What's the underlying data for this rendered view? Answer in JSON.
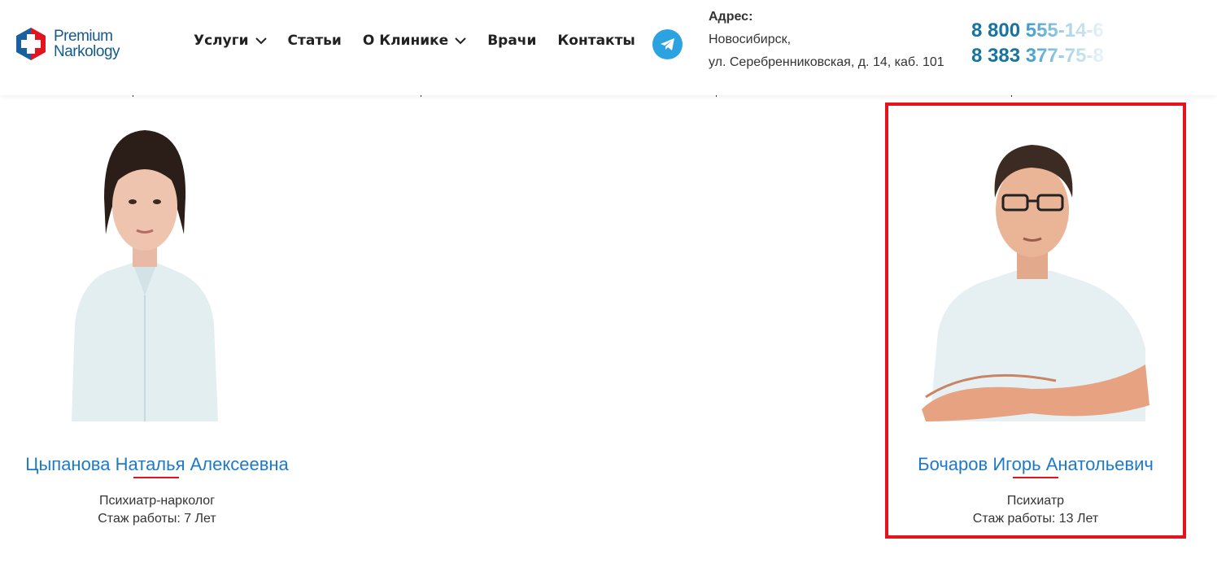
{
  "brand": {
    "line1": "Premium",
    "line2": "Narkology"
  },
  "nav": [
    {
      "label": "Услуги",
      "dropdown": true
    },
    {
      "label": "Статьи",
      "dropdown": false
    },
    {
      "label": "О Клинике",
      "dropdown": true
    },
    {
      "label": "Врачи",
      "dropdown": false
    },
    {
      "label": "Контакты",
      "dropdown": false
    }
  ],
  "contact": {
    "address_title": "Адрес:",
    "city": "Новосибирск,",
    "street": "ул. Серебренниковская, д. 14, каб. 101",
    "phone1_a": "8 800 ",
    "phone1_b": "555-14-6",
    "phone2_a": "8 383 ",
    "phone2_b": "377-75-8"
  },
  "doctors": [
    {
      "name": "Цыпанова Наталья Алексеевна",
      "specialty": "Психиатр-нарколог",
      "experience": "Стаж работы: 7 Лет"
    },
    {
      "name": "Бочаров Игорь Анатольевич",
      "specialty": "Психиатр",
      "experience": "Стаж работы: 13 Лет"
    }
  ],
  "colors": {
    "accent": "#1d7ac8",
    "highlight": "#e3141d",
    "phone": "#17739f",
    "telegram": "#2aa3e0"
  }
}
